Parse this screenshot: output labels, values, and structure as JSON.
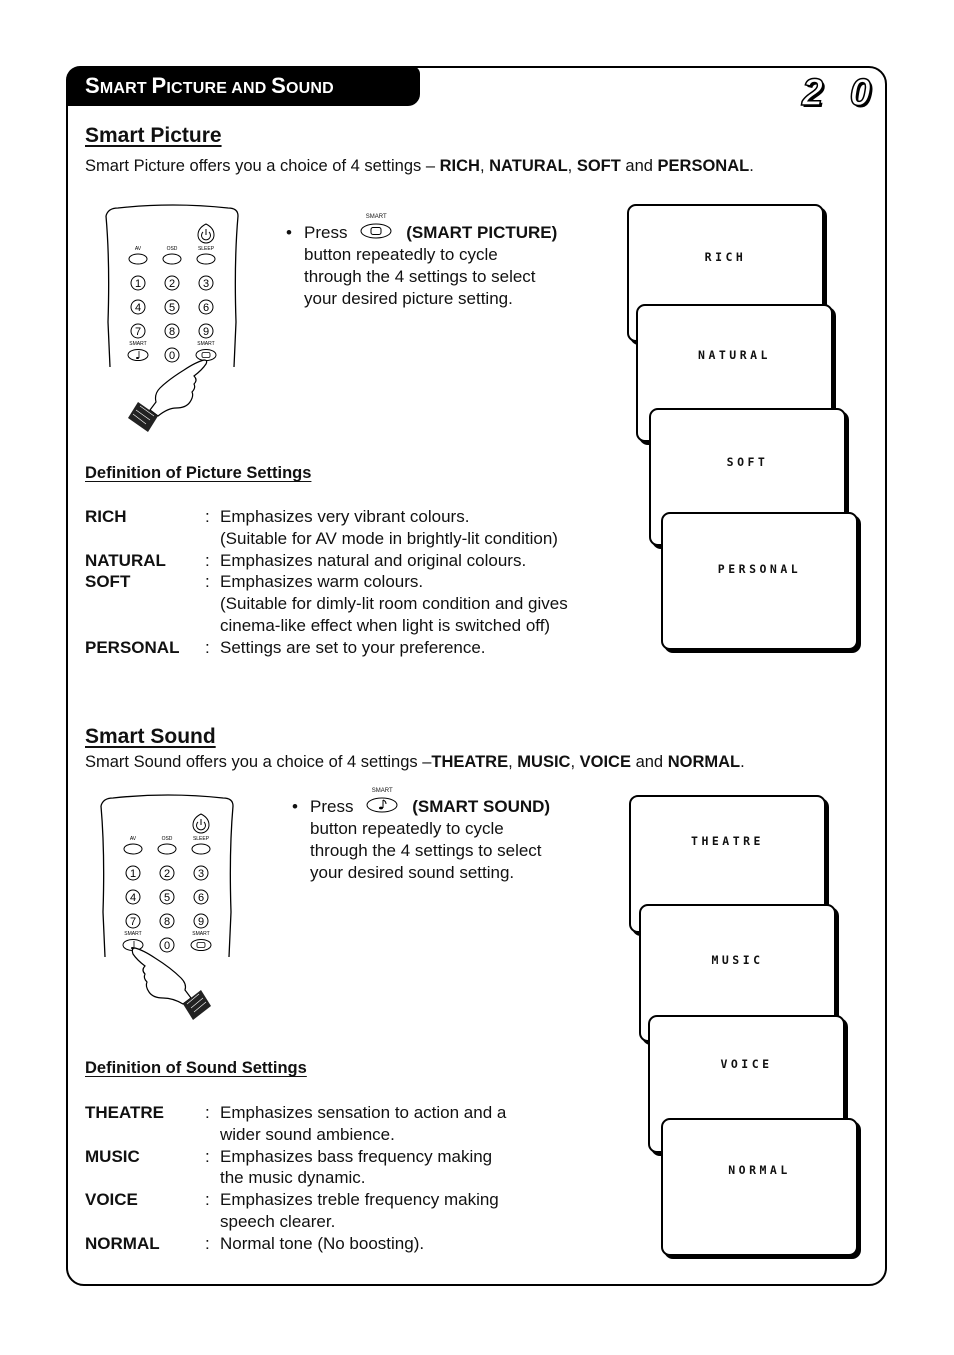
{
  "header": {
    "title_parts": [
      {
        "cap": "S",
        "rest": "MART "
      },
      {
        "cap": "P",
        "rest": "ICTURE AND "
      },
      {
        "cap": "S",
        "rest": "OUND"
      }
    ],
    "page_number": "2 0"
  },
  "smart_picture": {
    "heading": "Smart Picture",
    "intro": {
      "prefix": "Smart Picture offers you a choice of 4 settings – ",
      "options": [
        "RICH",
        "NATURAL",
        "SOFT",
        "PERSONAL"
      ],
      "sep1": ", ",
      "sep2": ", ",
      "sep3": " and ",
      "suffix": "."
    },
    "instruction": {
      "bullet": "•",
      "press": "Press",
      "button_caption": "SMART",
      "button_icon": "tv-screen-icon",
      "button_name": "(SMART PICTURE)",
      "lines": [
        "button repeatedly to cycle",
        "through the 4 settings to select",
        "your desired picture setting."
      ]
    },
    "remote": {
      "top_labels": [
        "AV",
        "OSD",
        "SLEEP"
      ],
      "digits": [
        "1",
        "2",
        "3",
        "4",
        "5",
        "6",
        "7",
        "8",
        "9",
        "0"
      ],
      "smart_label": "SMART",
      "pressed": "smart-picture"
    },
    "definitions_heading": "Definition of Picture Settings",
    "definitions": [
      {
        "term": "RICH",
        "desc": "Emphasizes very vibrant colours.\n(Suitable for AV mode in brightly-lit condition)"
      },
      {
        "term": "NATURAL",
        "desc": "Emphasizes natural and original colours."
      },
      {
        "term": "SOFT",
        "desc": "Emphasizes warm colours.\n(Suitable for dimly-lit room condition and gives\ncinema-like effect when light is switched off)"
      },
      {
        "term": "PERSONAL",
        "desc": "Settings are set to your preference."
      }
    ],
    "screens": [
      "RICH",
      "NATURAL",
      "SOFT",
      "PERSONAL"
    ]
  },
  "smart_sound": {
    "heading": "Smart Sound",
    "intro": {
      "prefix": "Smart Sound offers you a choice of 4 settings –",
      "options": [
        "THEATRE",
        "MUSIC",
        "VOICE",
        "NORMAL"
      ],
      "sep1": ", ",
      "sep2": ", ",
      "sep3": " and ",
      "suffix": "."
    },
    "instruction": {
      "bullet": "•",
      "press": "Press",
      "button_caption": "SMART",
      "button_icon": "music-note-icon",
      "button_name": "(SMART SOUND)",
      "lines": [
        "button repeatedly to cycle",
        "through the 4 settings to select",
        "your desired sound setting."
      ]
    },
    "remote": {
      "top_labels": [
        "AV",
        "OSD",
        "SLEEP"
      ],
      "digits": [
        "1",
        "2",
        "3",
        "4",
        "5",
        "6",
        "7",
        "8",
        "9",
        "0"
      ],
      "smart_label": "SMART",
      "pressed": "smart-sound"
    },
    "definitions_heading": "Definition of Sound Settings",
    "definitions": [
      {
        "term": "THEATRE",
        "desc": "Emphasizes sensation to action and a\nwider sound ambience."
      },
      {
        "term": "MUSIC",
        "desc": "Emphasizes bass frequency making\nthe music dynamic."
      },
      {
        "term": "VOICE",
        "desc": "Emphasizes treble frequency making\nspeech clearer."
      },
      {
        "term": "NORMAL",
        "desc": "Normal tone (No boosting)."
      }
    ],
    "screens": [
      "THEATRE",
      "MUSIC",
      "VOICE",
      "NORMAL"
    ]
  },
  "common": {
    "colon": ":"
  }
}
